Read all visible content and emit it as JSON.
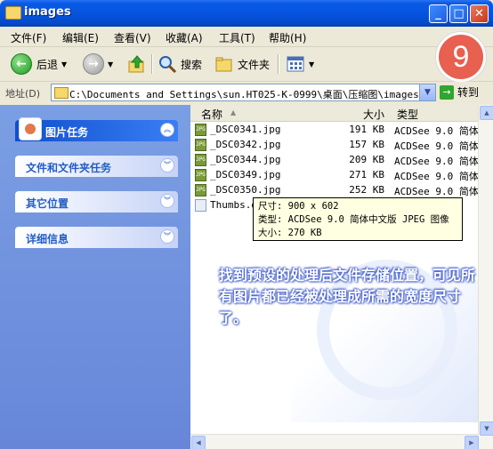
{
  "window": {
    "title": "images"
  },
  "menu": [
    "文件(F)",
    "编辑(E)",
    "查看(V)",
    "收藏(A)",
    "工具(T)",
    "帮助(H)"
  ],
  "toolbar": {
    "back": "后退",
    "search": "搜索",
    "folders": "文件夹"
  },
  "address": {
    "label": "地址(D)",
    "path": "C:\\Documents and Settings\\sun.HT025-K-0999\\桌面\\压缩图\\images",
    "go": "转到"
  },
  "step_badge": "9",
  "tasks": [
    {
      "label": "图片任务"
    },
    {
      "label": "文件和文件夹任务"
    },
    {
      "label": "其它位置"
    },
    {
      "label": "详细信息"
    }
  ],
  "columns": {
    "name": "名称",
    "size": "大小",
    "type": "类型"
  },
  "files": [
    {
      "name": "_DSC0341.jpg",
      "size": "191 KB",
      "type": "ACDSee 9.0 简体..."
    },
    {
      "name": "_DSC0342.jpg",
      "size": "157 KB",
      "type": "ACDSee 9.0 简体..."
    },
    {
      "name": "_DSC0344.jpg",
      "size": "209 KB",
      "type": "ACDSee 9.0 简体..."
    },
    {
      "name": "_DSC0349.jpg",
      "size": "271 KB",
      "type": "ACDSee 9.0 简体..."
    },
    {
      "name": "_DSC0350.jpg",
      "size": "252 KB",
      "type": "ACDSee 9.0 简体..."
    },
    {
      "name": "Thumbs.d",
      "size": "",
      "type": ""
    }
  ],
  "tooltip": {
    "line1": "尺寸: 900 x 602",
    "line2": "类型: ACDSee 9.0 简体中文版 JPEG 图像",
    "line3": "大小: 270 KB"
  },
  "annotation": "找到预设的处理后文件存储位置，可见所有图片都已经被处理成所需的宽度尺寸了。"
}
